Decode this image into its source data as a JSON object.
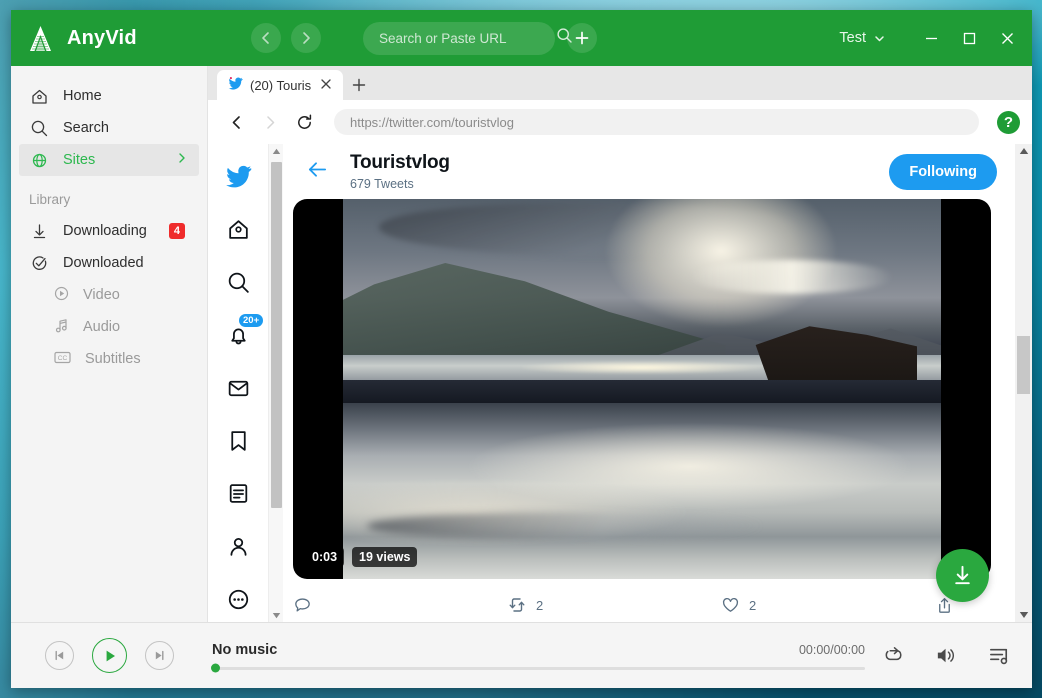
{
  "app": {
    "brand": "AnyVid",
    "brand_logo_icon": "anyvid-logo-icon",
    "accent_green": "#1f9c36",
    "nav_back_icon": "chevron-left-icon",
    "nav_forward_icon": "chevron-right-icon",
    "search": {
      "placeholder": "Search or Paste URL",
      "value": "",
      "search_icon": "search-icon"
    },
    "add_icon": "plus-icon",
    "account": {
      "label": "Test",
      "caret_icon": "chevron-down-icon"
    },
    "window_controls": {
      "minimize_icon": "minimize-icon",
      "maximize_icon": "maximize-icon",
      "close_icon": "close-icon"
    }
  },
  "sidebar": {
    "items": [
      {
        "label": "Home",
        "icon": "home-icon",
        "active": false
      },
      {
        "label": "Search",
        "icon": "search-icon",
        "active": false
      },
      {
        "label": "Sites",
        "icon": "globe-icon",
        "active": true,
        "chevron_icon": "chevron-right-icon"
      }
    ],
    "section_label": "Library",
    "library": [
      {
        "label": "Downloading",
        "icon": "download-arrow-icon",
        "badge": "4"
      },
      {
        "label": "Downloaded",
        "icon": "check-circle-icon",
        "badge": ""
      }
    ],
    "sub_items": [
      {
        "label": "Video",
        "icon": "play-circle-icon"
      },
      {
        "label": "Audio",
        "icon": "music-note-icon"
      },
      {
        "label": "Subtitles",
        "icon": "cc-icon"
      }
    ]
  },
  "browser": {
    "tab": {
      "favicon": "twitter-bird-icon",
      "title": "(20) Touris",
      "close_icon": "close-icon"
    },
    "new_tab_icon": "plus-icon",
    "back_icon": "chevron-left-icon",
    "forward_icon": "chevron-right-icon",
    "reload_icon": "reload-icon",
    "url": "https://twitter.com/touristvlog",
    "help_label": "?"
  },
  "twitter": {
    "nav_icons": [
      {
        "name": "twitter-bird-icon",
        "badge": ""
      },
      {
        "name": "home-icon",
        "badge": ""
      },
      {
        "name": "search-icon",
        "badge": ""
      },
      {
        "name": "notifications-bell-icon",
        "badge": "20+"
      },
      {
        "name": "messages-envelope-icon",
        "badge": ""
      },
      {
        "name": "bookmark-icon",
        "badge": ""
      },
      {
        "name": "lists-icon",
        "badge": ""
      },
      {
        "name": "profile-person-icon",
        "badge": ""
      },
      {
        "name": "more-ellipsis-icon",
        "badge": ""
      }
    ],
    "profile": {
      "back_icon": "arrow-left-icon",
      "name": "Touristvlog",
      "tweets_count": "679 Tweets",
      "follow_button": "Following",
      "follow_color": "#1d9bf0"
    },
    "tweet": {
      "video_duration": "0:03",
      "video_views": "19 views",
      "actions": [
        {
          "icon": "reply-icon",
          "count": ""
        },
        {
          "icon": "retweet-icon",
          "count": "2"
        },
        {
          "icon": "like-heart-icon",
          "count": "2"
        },
        {
          "icon": "share-icon",
          "count": ""
        }
      ]
    },
    "download_fab_icon": "download-icon"
  },
  "player": {
    "prev_icon": "skip-previous-icon",
    "play_icon": "play-icon",
    "next_icon": "skip-next-icon",
    "title": "No music",
    "time": "00:00/00:00",
    "progress_percent": 0,
    "repeat_icon": "repeat-icon",
    "volume_icon": "volume-icon",
    "playlist_icon": "playlist-icon"
  }
}
